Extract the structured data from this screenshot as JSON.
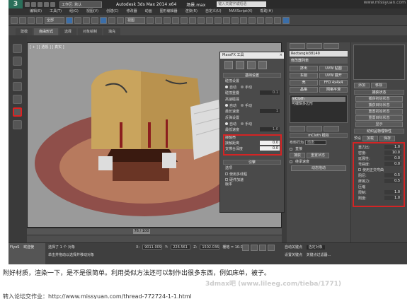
{
  "window": {
    "app_name": "Autodesk 3ds Max  2014 x64",
    "file_name": "场景.max",
    "workspace": "工作区: 默认",
    "search_placeholder": "键入关键字或短语",
    "corner_mark": "www.missyuan.com"
  },
  "menus": [
    "编辑(E)",
    "工具(T)",
    "组(G)",
    "视图(V)",
    "创建(C)",
    "修改器",
    "动画",
    "图形编辑器",
    "渲染(R)",
    "自定义(U)",
    "MAXScript(X)",
    "帮助(H)"
  ],
  "toolbar": {
    "selection_filter": "全部",
    "view_dropdown": "视图"
  },
  "ribbon_tabs": [
    {
      "label": "建模",
      "active": false
    },
    {
      "label": "自由形式",
      "active": true
    },
    {
      "label": "选择",
      "active": false
    },
    {
      "label": "对象绘制",
      "active": false
    },
    {
      "label": "填充",
      "active": false
    }
  ],
  "viewport": {
    "label": "[ + ] [ 透视 ] [ 真实 ]"
  },
  "massfx": {
    "title": "MassFX 工具",
    "close": "×",
    "section_general": "基础设置",
    "substeps_group": "碰撞设置",
    "auto": "自动",
    "manual": "手动",
    "collision_overlap": "碰撞重叠",
    "collision_overlap_value": "0.1",
    "sub_group": "高速碰撞",
    "auto2": "自动",
    "manual2": "手动",
    "iterations": "最长速度",
    "iterations_value": "1",
    "sleep_group": "反弹设置",
    "auto3": "自动",
    "manual3": "手动",
    "min_speed": "最低速度",
    "min_speed_value": "1.0",
    "contact_group": "接触壳",
    "contact_distance": "接触距离",
    "contact_distance_value": "0.0",
    "support_depth": "支撑台深度",
    "support_depth_value": "0.0",
    "engine_section": "引擎",
    "options": "选项",
    "use_multithread": "使用多线程",
    "hardware_accel": "硬件加速",
    "version": "版本"
  },
  "command_panel": {
    "object_name": "Rectangle38149",
    "modifier_list": "修改器列表",
    "mod_buttons": [
      "挤出",
      "UVW 贴图",
      "车削",
      "UVW 展开",
      "壳",
      "FFD 4x4x4",
      "晶格",
      "网格平滑"
    ],
    "stack_items": [
      "mCloth",
      "可编辑多边形"
    ],
    "stack_selected_index": 0,
    "cloth_section": "mCloth 模拟",
    "cloth_behavior_label": "布料行为",
    "cloth_behavior_value": "动态",
    "direct_cache": "直接",
    "capture_state": "捕获",
    "reset_state": "重置状态",
    "reset_state_check": "继承速度",
    "dynamic_drag": "动态拖动"
  },
  "right_panel": {
    "add_button": "添加",
    "remove_button": "移除",
    "capture_section": "捕获状态",
    "capture_buttons": [
      "捕获初始状态",
      "捕获目标状态",
      "重置初始状态",
      "重置目标状态",
      "显示"
    ],
    "physical_section": "纺织品物理特性",
    "preset_load": "加载",
    "preset_save": "保存",
    "preset_label": "预设",
    "properties": [
      {
        "label": "重力比:",
        "value": "1.0"
      },
      {
        "label": "密度:",
        "value": "10.0"
      },
      {
        "label": "延展性:",
        "value": "0.0"
      },
      {
        "label": "弯曲度:",
        "value": "0.0"
      }
    ],
    "orthogonal_bend": "使用正交弯曲",
    "damping_rows": [
      {
        "label": "阻尼:",
        "value": "0.5"
      },
      {
        "label": "摩擦力:",
        "value": "0.5"
      }
    ],
    "compression_section": "压缩",
    "compression_rows": [
      {
        "label": "限制:",
        "value": "1.0"
      },
      {
        "label": "刚度:",
        "value": "1.0"
      }
    ]
  },
  "timeline": {
    "frame": "76 / 100"
  },
  "status": {
    "maxscript_label": "FlyoS",
    "welcome": "欢迎使",
    "selected": "选择了 1 个 对象",
    "hint": "单击并拖动以选择并移动对象",
    "x_label": "X:",
    "x_value": "9011.009",
    "y_label": "Y:",
    "y_value": "226.561",
    "z_label": "Z:",
    "z_value": "1502.036",
    "grid": "栅格 = 10.0",
    "auto_key": "自动关键点",
    "selected_obj": "选定对象",
    "set_key": "设置关键点",
    "key_filters": "关键点过滤器..."
  },
  "article": {
    "caption": "附好材质，渲染一下，是不是很简单。利用类似方法还可以制作出很多东西，例如床单，被子。",
    "watermark": "3dmax吧 (www.lileeg.com/tieba/1771)",
    "url": "转入论坛交作业：http://www.missyuan.com/thread-772724-1-1.html"
  }
}
